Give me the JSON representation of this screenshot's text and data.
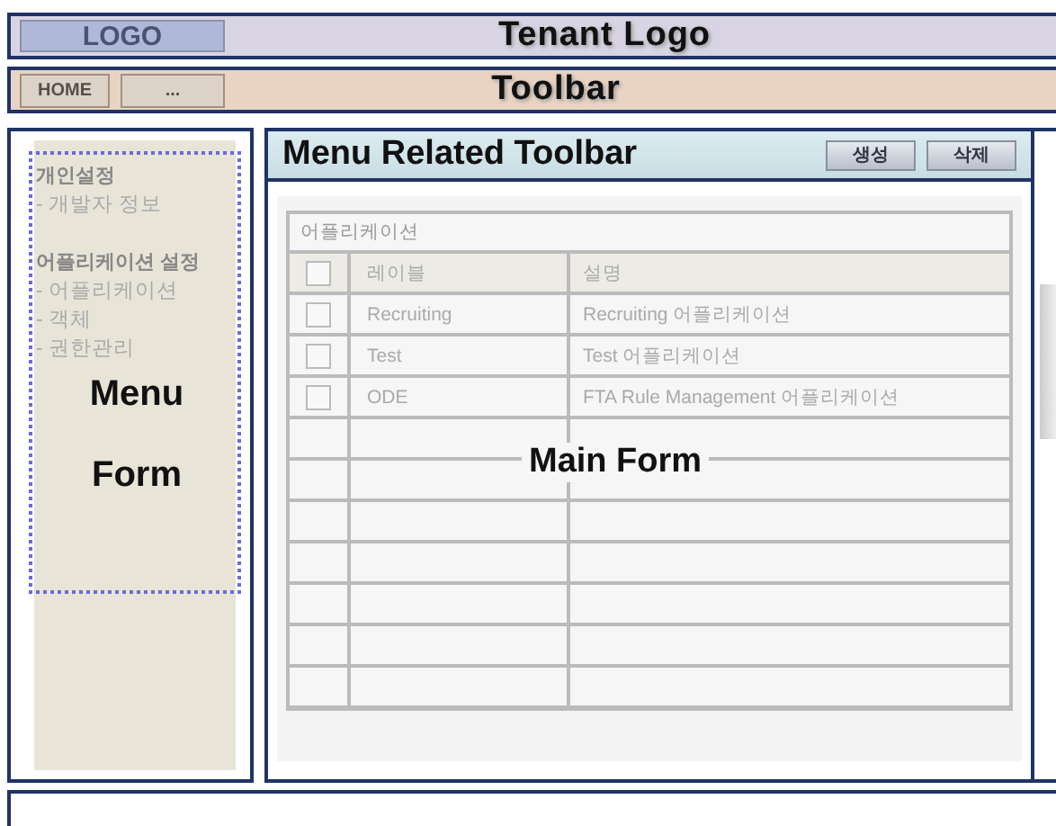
{
  "header": {
    "logo": "LOGO",
    "title": "Tenant Logo"
  },
  "toolbar": {
    "buttons": [
      "HOME",
      "..."
    ],
    "title": "Toolbar"
  },
  "menu_panel": {
    "groups": [
      {
        "title": "개인설정",
        "items": [
          "- 개발자 정보"
        ]
      },
      {
        "title": "어플리케이션 설정",
        "items": [
          "- 어플리케이션",
          "- 객체",
          "- 권한관리"
        ]
      }
    ],
    "annotation": [
      "Menu",
      "Form"
    ]
  },
  "main_panel": {
    "title": "Menu Related Toolbar",
    "buttons": [
      "생성",
      "삭제"
    ],
    "table": {
      "caption": "어플리케이션",
      "select_all_checked": false,
      "columns": [
        "레이블",
        "설명"
      ],
      "rows": [
        {
          "checked": false,
          "label": "Recruiting",
          "description": "Recruiting 어플리케이션"
        },
        {
          "checked": false,
          "label": "Test",
          "description": "Test 어플리케이션"
        },
        {
          "checked": false,
          "label": "ODE",
          "description": "FTA Rule Management 어플리케이션"
        }
      ]
    },
    "annotation": "Main Form"
  }
}
